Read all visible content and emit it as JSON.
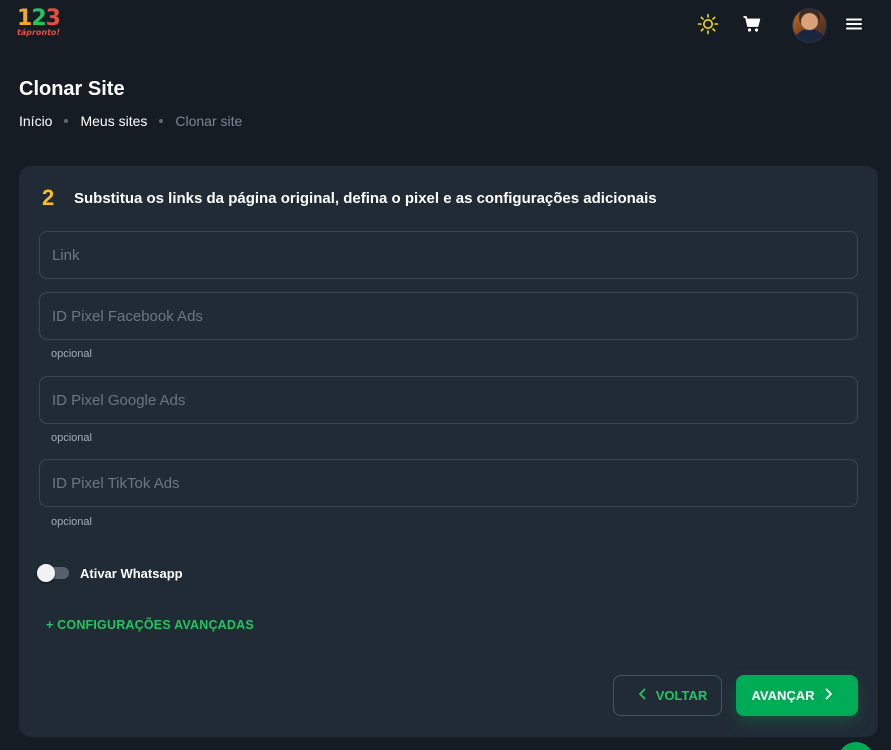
{
  "header": {
    "logo_numbers": [
      "1",
      "2",
      "3"
    ],
    "logo_sub": "tápronto!",
    "icons": [
      "sun-icon",
      "cart-icon",
      "avatar",
      "menu-icon"
    ],
    "accent": "#f5d90a"
  },
  "page": {
    "title": "Clonar Site",
    "breadcrumb": [
      "Início",
      "Meus sites",
      "Clonar site"
    ]
  },
  "form": {
    "step_number": "2",
    "step_title": "Substitua os links da página original, defina o pixel e as configurações adicionais",
    "fields": [
      {
        "placeholder": "Link",
        "value": "",
        "hint": ""
      },
      {
        "placeholder": "ID Pixel Facebook Ads",
        "value": "",
        "hint": "opcional"
      },
      {
        "placeholder": "ID Pixel Google Ads",
        "value": "",
        "hint": "opcional"
      },
      {
        "placeholder": "ID Pixel TikTok Ads",
        "value": "",
        "hint": "opcional"
      }
    ],
    "whatsapp_toggle": {
      "label": "Ativar Whatsapp",
      "on": false
    },
    "advanced_link": "+ CONFIGURAÇÕES AVANÇADAS",
    "back_label": "VOLTAR",
    "next_label": "AVANÇAR"
  },
  "colors": {
    "background": "#161c24",
    "card": "#212b36",
    "primary": "#00ab55",
    "step_accent": "#fbbf24"
  }
}
